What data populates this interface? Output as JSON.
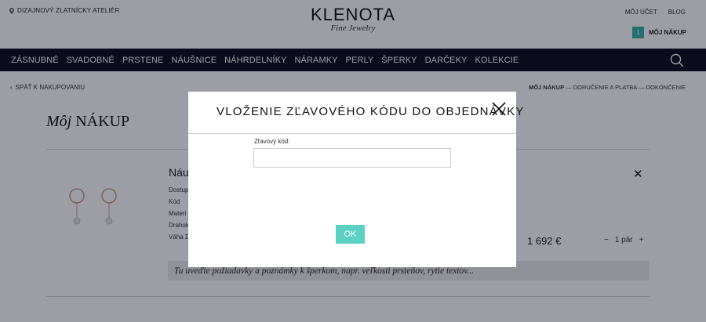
{
  "header": {
    "atelier_label": "DIZAJNOVÝ ZLATNÍCKY ATELIÉR",
    "logo_main": "KLENOTA",
    "logo_sub": "Fine Jewelry",
    "account_label": "MÔJ ÚČET",
    "blog_label": "BLOG",
    "cart_count": "1",
    "cart_label": "MÔJ NÁKUP"
  },
  "nav": {
    "items": [
      "ZÁSNUBNÉ",
      "SVADOBNÉ",
      "PRSTENE",
      "NÁUŠNICE",
      "NÁHRDELNÍKY",
      "NÁRAMKY",
      "PERLY",
      "ŠPERKY",
      "DARČEKY",
      "KOLEKCIE"
    ],
    "background": "#0b0b1c"
  },
  "page": {
    "back_label": "SPÄŤ K NAKUPOVANIU",
    "steps": {
      "active": "MÔJ NÁKUP",
      "rest": " — DORUČENIE A PLATBA — DOKONČENIE"
    },
    "title_italic": "Môj",
    "title_rest": " NÁKUP",
    "product": {
      "name": "Náu",
      "specs": [
        "Dostup",
        "Kód",
        "Materi",
        "Drahok",
        "Váha Σ"
      ],
      "price": "1 692 €",
      "qty_minus": "−",
      "qty_value": "1 pár",
      "qty_plus": "+",
      "remove_icon": "close-icon"
    },
    "note_placeholder": "Tu uveďte požiadavky a poznámky k šperkom, napr. veľkosti prsteňov, rytie textov..."
  },
  "modal": {
    "title": "VLOŽENIE ZĽAVOVÉHO KÓDU DO OBJEDNÁVKY",
    "field_label": "Zľavový kód:",
    "field_value": "",
    "ok_label": "OK",
    "accent": "#5ad1c2"
  }
}
